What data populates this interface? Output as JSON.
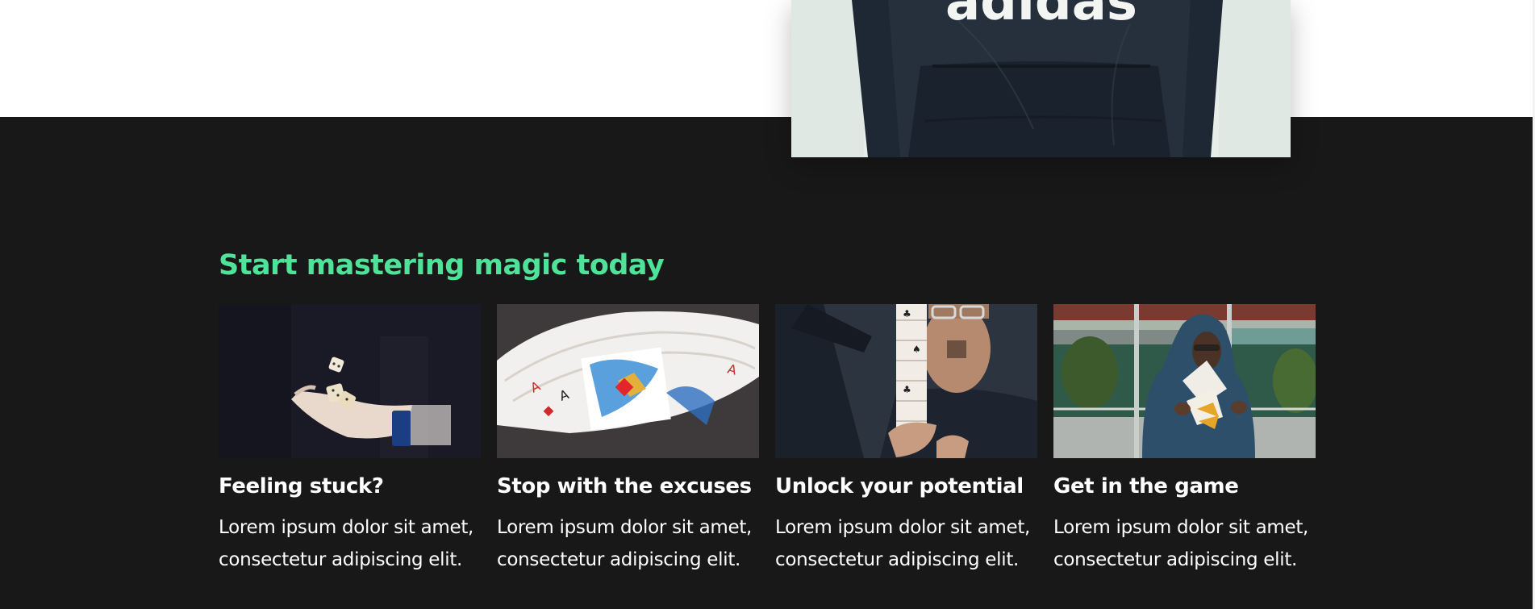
{
  "hero": {
    "hoodie_brand_text": "adidas"
  },
  "section": {
    "heading": "Start mastering magic today",
    "heading_color": "#4fe39a",
    "background_color": "#181818"
  },
  "cards": [
    {
      "title": "Feeling stuck?",
      "text": "Lorem ipsum dolor sit amet, consectetur adipiscing elit.",
      "image": "hand-tossing-dice-photo"
    },
    {
      "title": "Stop with the excuses",
      "text": "Lorem ipsum dolor sit amet, consectetur adipiscing elit.",
      "image": "fanned-playing-cards-photo"
    },
    {
      "title": "Unlock your potential",
      "text": "Lorem ipsum dolor sit amet, consectetur adipiscing elit.",
      "image": "man-cascading-cards-photo"
    },
    {
      "title": "Get in the game",
      "text": "Lorem ipsum dolor sit amet, consectetur adipiscing elit.",
      "image": "hooded-person-card-flourish-photo"
    }
  ]
}
